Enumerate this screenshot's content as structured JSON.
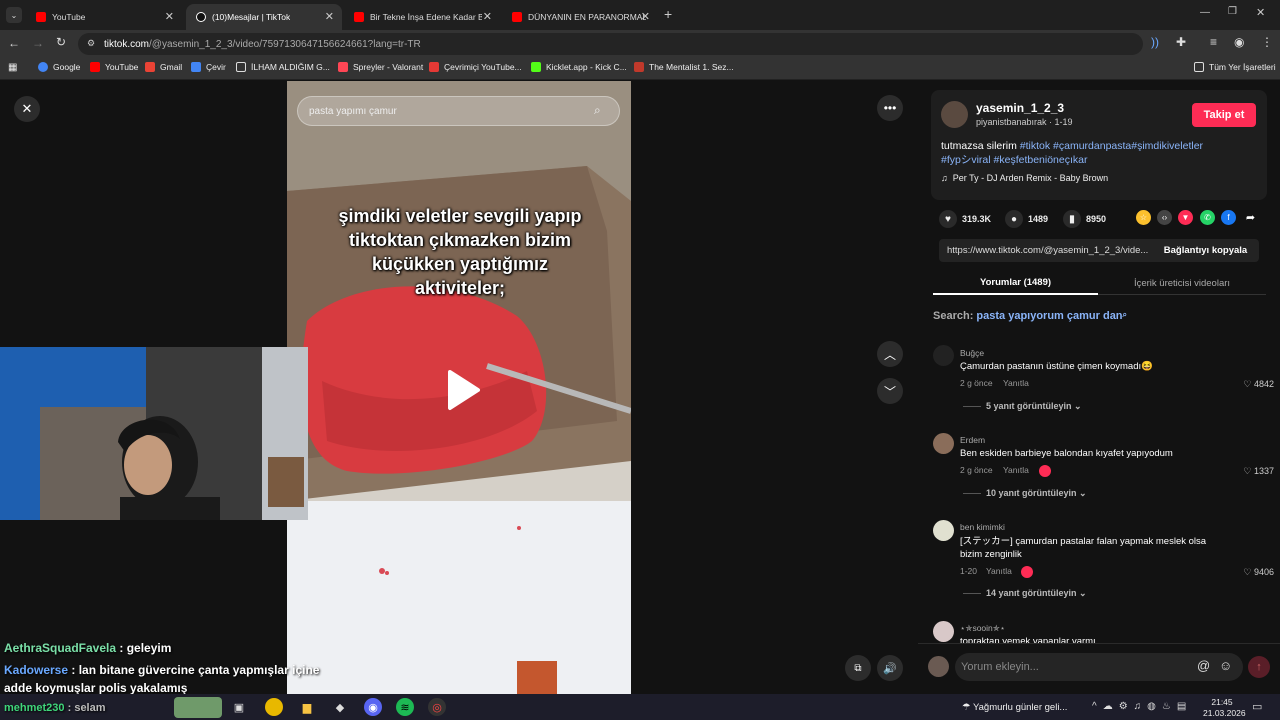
{
  "tabs": [
    {
      "title": "YouTube",
      "color": "#ff0000",
      "active": false
    },
    {
      "title": "(10)Mesajlar | TikTok",
      "color": "#111111",
      "active": true
    },
    {
      "title": "Bir Tekne İnşa Edene Kadar Bir...",
      "color": "#ff0000",
      "active": false
    },
    {
      "title": "DÜNYANIN EN PARANORMAL...",
      "color": "#ff0000",
      "active": false
    }
  ],
  "address": {
    "host": "tiktok.com",
    "path": "/@yasemin_1_2_3/video/7597130647156624661?lang=tr-TR"
  },
  "bookmarks": [
    {
      "label": "Google",
      "color": "#4285f4"
    },
    {
      "label": "YouTube",
      "color": "#ff0000"
    },
    {
      "label": "Gmail",
      "color": "#ea4335"
    },
    {
      "label": "Çevir",
      "color": "#4285f4"
    },
    {
      "label": "İLHAM ALDIĞIM G...",
      "color": "#dddddd"
    },
    {
      "label": "Spreyler - Valorant",
      "color": "#ff4655"
    },
    {
      "label": "Çevrimiçi YouTube...",
      "color": "#e53935"
    },
    {
      "label": "Kicklet.app - Kick C...",
      "color": "#53fc18"
    },
    {
      "label": "The Mentalist 1. Sez...",
      "color": "#c0392b"
    }
  ],
  "bookmarks_all": "Tüm Yer İşaretleri",
  "video": {
    "search_placeholder": "pasta yapımı çamur",
    "overlay_lines": [
      "şimdiki veletler sevgili yapıp",
      "tiktoktan çıkmazken bizim",
      "küçükken yaptığımız",
      "aktiviteler;"
    ]
  },
  "stream_chat": [
    {
      "user": "AethraSquadFavela",
      "user_color": "#7be0a8",
      "text": " : geleyim"
    },
    {
      "user": "Kadowerse",
      "user_color": "#6aa8ff",
      "text": " : lan bitane güvercine çanta yapmışlar içine"
    },
    {
      "user": "",
      "user_color": "#ffffff",
      "text": "adde koymuşlar polis yakalamış"
    },
    {
      "user": "mehmet230",
      "user_color": "#3fd67a",
      "text": " : selam"
    }
  ],
  "creator": {
    "username": "yasemin_1_2_3",
    "subline": "piyanistbanabırak · 1-19",
    "follow_label": "Takip et",
    "caption": "tutmazsa silerim",
    "hashtags_line1": "#tiktok #çamurdanpasta#şimdikiveletler",
    "hashtags_line2": "#fypシviral #keşfetbeniöneçıkar",
    "music": "Per Ty - DJ Arden Remix - Baby Brown"
  },
  "stats": {
    "likes": "319.3K",
    "comments": "1489",
    "saves": "8950"
  },
  "share_colors": [
    "#fbc02d",
    "#444444",
    "#fe2c55",
    "#25d366",
    "#1877f2"
  ],
  "link": {
    "url": "https://www.tiktok.com/@yasemin_1_2_3/vide...",
    "copy_label": "Bağlantıyı kopyala"
  },
  "panel_tabs": {
    "comments": "Yorumlar (1489)",
    "creator_videos": "İçerik üreticisi videoları"
  },
  "search_hint": {
    "prefix": "Search:",
    "query": "pasta yapıyorum çamur dan"
  },
  "comments": [
    {
      "user": "Buğçe",
      "text": "Çamurdan pastanın üstüne çimen koymadı😆",
      "time": "2 g önce",
      "reply": "Yanıtla",
      "likes": "4842",
      "replies": "5 yanıt görüntüleyin",
      "avatar": "#222222"
    },
    {
      "user": "Erdem",
      "text": "Ben eskiden barbieye balondan kıyafet yapıyodum",
      "time": "2 g önce",
      "reply": "Yanıtla",
      "likes": "1337",
      "replies": "10 yanıt görüntüleyin",
      "avatar": "#8a6d5a"
    },
    {
      "user": "ben kimimki",
      "text": "[ステッカー] çamurdan pastalar falan yapmak meslek olsa",
      "text2": "bizim zenginlik",
      "time": "1-20",
      "reply": "Yanıtla",
      "likes": "9406",
      "replies": "14 yanıt görüntüleyin",
      "avatar": "#e0e0d0"
    },
    {
      "user": "⋆✯sooin✯⋆",
      "text": "topraktan yemek yapanlar varmı",
      "avatar": "#d8c8c8"
    }
  ],
  "comment_input_placeholder": "Yorum ekleyin...",
  "taskbar": {
    "weather": "Yağmurlu günler geli...",
    "time": "21:45",
    "date": "21.03.2026"
  }
}
